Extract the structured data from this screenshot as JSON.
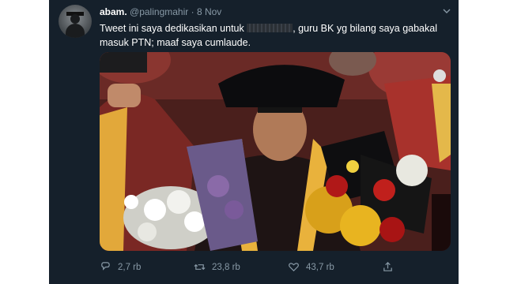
{
  "tweet": {
    "display_name": "abam.",
    "handle": "@palingmahir",
    "separator": "·",
    "date": "8 Nov",
    "text_part1": "Tweet ini saya dedikasikan untuk",
    "text_part2": ", guru BK yg bilang saya gabakal masuk PTN; maaf saya cumlaude."
  },
  "photo": {
    "description_icon": "graduation-photo"
  },
  "actions": {
    "replies": "2,7 rb",
    "retweets": "23,8 rb",
    "likes": "43,7 rb"
  },
  "colors": {
    "background": "#15202b",
    "secondary_text": "#8899a6",
    "page": "#ffffff"
  }
}
